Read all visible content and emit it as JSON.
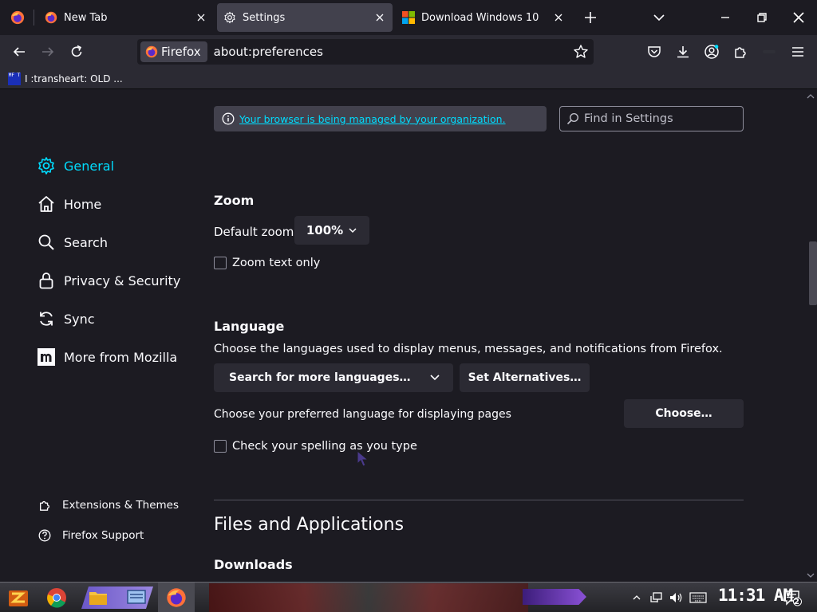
{
  "tabs": [
    {
      "title": "New Tab"
    },
    {
      "title": "Settings"
    },
    {
      "title": "Download Windows 10"
    }
  ],
  "urlbar": {
    "identity_label": "Firefox",
    "url": "about:preferences"
  },
  "bookmarks": {
    "item_label": "I :transheart: OLD ...",
    "favicon_text": "MF T"
  },
  "sidebar": {
    "categories": [
      {
        "label": "General",
        "icon": "gear-icon"
      },
      {
        "label": "Home",
        "icon": "home-icon"
      },
      {
        "label": "Search",
        "icon": "search-icon"
      },
      {
        "label": "Privacy & Security",
        "icon": "lock-icon"
      },
      {
        "label": "Sync",
        "icon": "sync-icon"
      },
      {
        "label": "More from Mozilla",
        "icon": "mozilla-icon"
      }
    ],
    "extensions_label": "Extensions & Themes",
    "support_label": "Firefox Support"
  },
  "notice": {
    "text": "Your browser is being managed by your organization."
  },
  "search": {
    "placeholder": "Find in Settings"
  },
  "zoom": {
    "heading": "Zoom",
    "default_zoom_label": "Default zoom",
    "default_zoom_value": "100%",
    "text_only_label": "Zoom text only",
    "text_only_checked": false
  },
  "language": {
    "heading": "Language",
    "description": "Choose the languages used to display menus, messages, and notifications from Firefox.",
    "search_more_label": "Search for more languages…",
    "set_alternatives_label": "Set Alternatives…",
    "preferred_label": "Choose your preferred language for displaying pages",
    "choose_label": "Choose…",
    "spellcheck_label": "Check your spelling as you type",
    "spellcheck_checked": false
  },
  "files": {
    "heading": "Files and Applications",
    "downloads_heading": "Downloads"
  },
  "taskbar": {
    "clock": "11:31 AM",
    "notification_count": "2"
  },
  "colors": {
    "accent": "#00ddff",
    "background": "#1c1b22",
    "toolbar": "#2b2a33",
    "selected_tab": "#42414d"
  }
}
